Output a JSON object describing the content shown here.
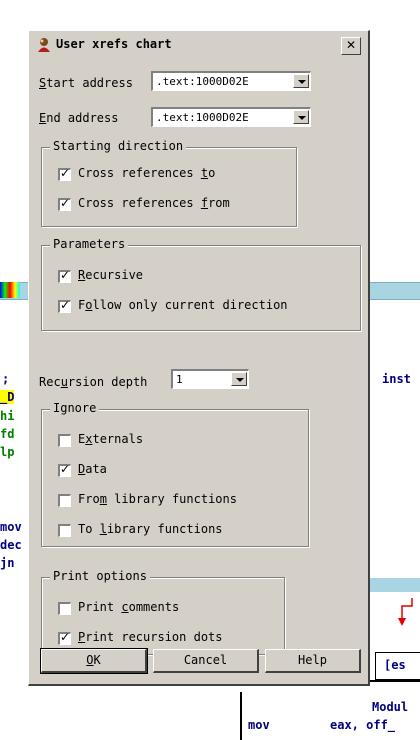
{
  "dialog": {
    "title": "User xrefs chart",
    "close_glyph": "✕",
    "start_address": {
      "label": "Start address",
      "underline": "S",
      "rest": "tart address",
      "value": ".text:1000D02E"
    },
    "end_address": {
      "label": "End address",
      "underline": "E",
      "rest": "nd address",
      "value": ".text:1000D02E"
    },
    "starting_direction": {
      "title": "Starting direction",
      "items": [
        {
          "pre": "Cross references ",
          "u": "t",
          "post": "o",
          "checked": true
        },
        {
          "pre": "Cross references ",
          "u": "f",
          "post": "rom",
          "checked": true
        }
      ]
    },
    "parameters": {
      "title": "Parameters",
      "items": [
        {
          "pre": "",
          "u": "R",
          "post": "ecursive",
          "checked": true
        },
        {
          "pre": "F",
          "u": "o",
          "post": "llow only current direction",
          "checked": true
        }
      ]
    },
    "recursion_depth": {
      "pre": "Rec",
      "u": "u",
      "post": "rsion depth",
      "value": "1"
    },
    "ignore": {
      "title": "Ignore",
      "items": [
        {
          "pre": "E",
          "u": "x",
          "post": "ternals",
          "checked": false
        },
        {
          "pre": "",
          "u": "D",
          "post": "ata",
          "checked": true
        },
        {
          "pre": "Fro",
          "u": "m",
          "post": " library functions",
          "checked": false
        },
        {
          "pre": "To ",
          "u": "l",
          "post": "ibrary functions",
          "checked": false
        }
      ]
    },
    "print_options": {
      "title": "Print options",
      "items": [
        {
          "pre": "Print ",
          "u": "c",
          "post": "omments",
          "checked": false
        },
        {
          "pre": "",
          "u": "P",
          "post": "rint recursion dots",
          "checked": true
        }
      ]
    },
    "buttons": {
      "ok_u": "O",
      "ok_rest": "K",
      "cancel": "Cancel",
      "help": "Help"
    }
  },
  "background": {
    "code_lines": [
      ";",
      "_D",
      "hi",
      "fd",
      "lp",
      "mov",
      "dec",
      "jn"
    ],
    "right_text": "inst",
    "esp_text": "[es",
    "modul_text": "Modul",
    "bottom_mov": "mov",
    "bottom_operand": "eax, off_"
  }
}
